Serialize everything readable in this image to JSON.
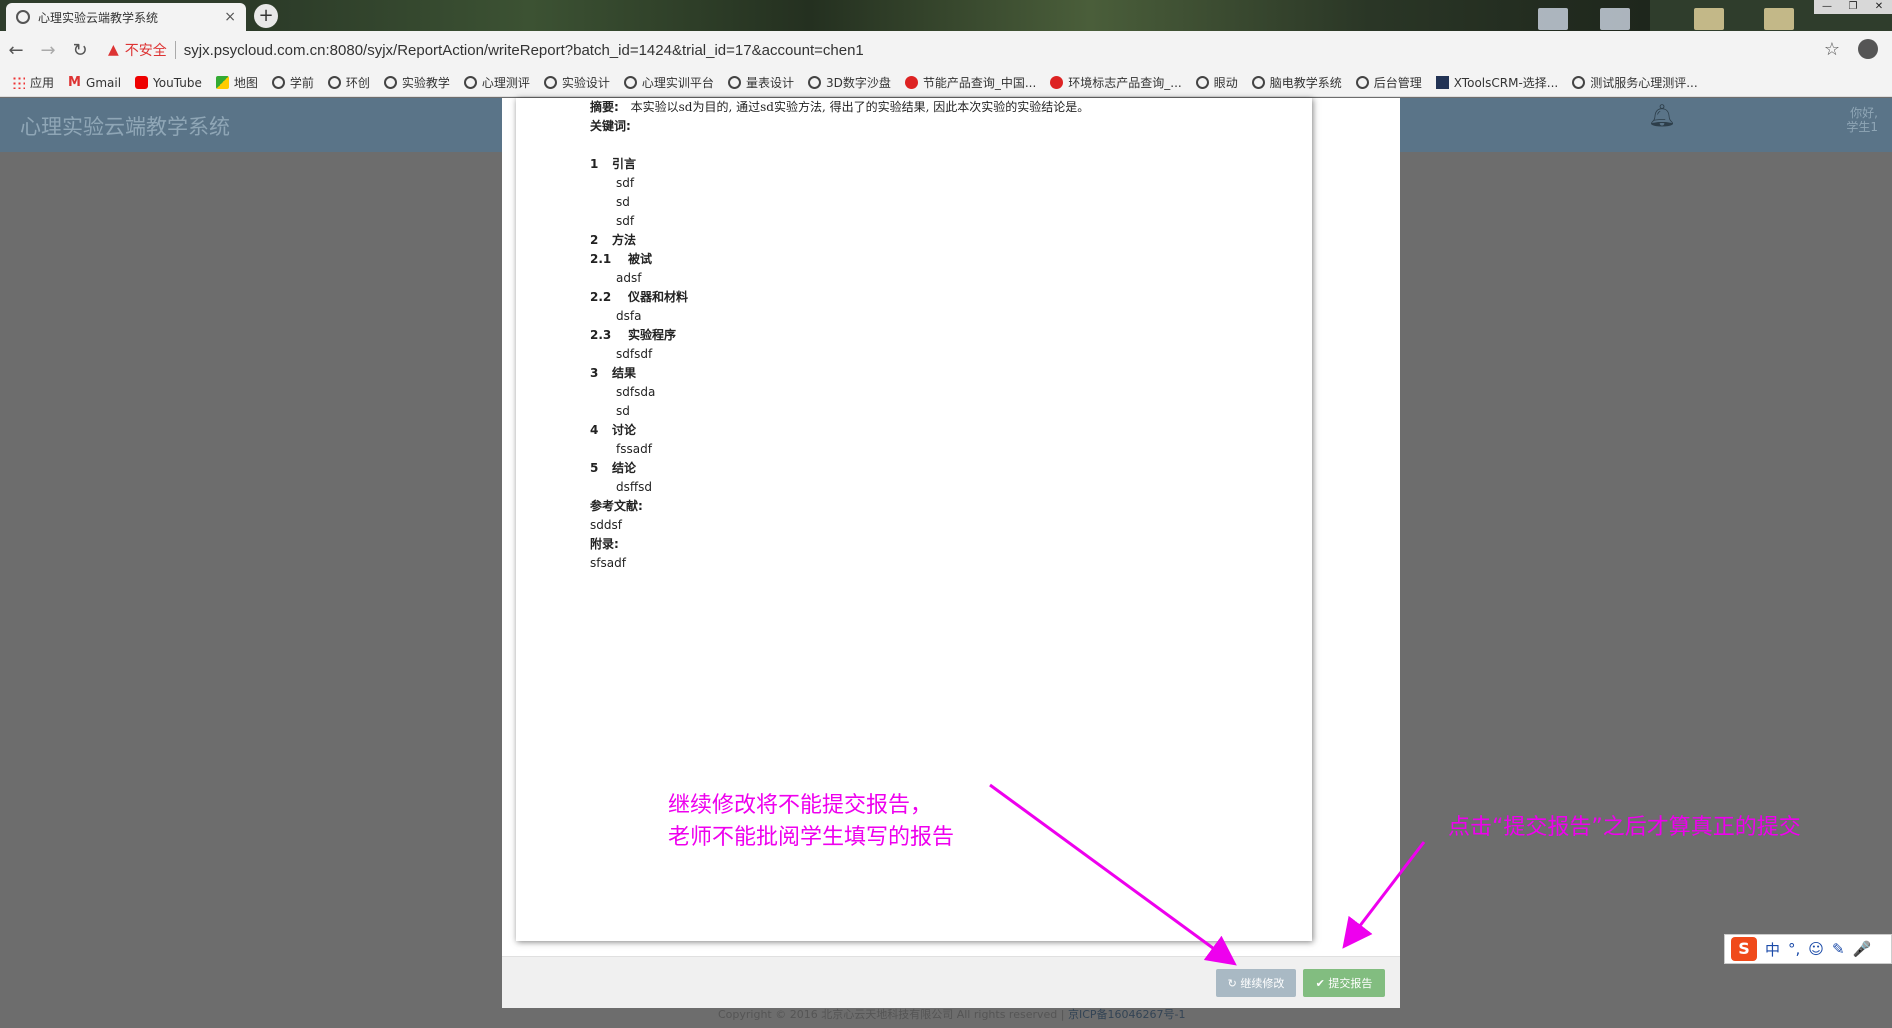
{
  "browser": {
    "tab_title": "心理实验云端教学系统",
    "tab_close": "×",
    "new_tab": "+",
    "unsafe_label": "不安全",
    "url": "syjx.psycloud.com.cn:8080/syjx/ReportAction/writeReport?batch_id=1424&trial_id=17&account=chen1",
    "bookmarks": [
      {
        "label": "应用",
        "icon": "apps-icon"
      },
      {
        "label": "Gmail",
        "icon": "gmail-icon"
      },
      {
        "label": "YouTube",
        "icon": "youtube-icon"
      },
      {
        "label": "地图",
        "icon": "maps-icon"
      },
      {
        "label": "学前",
        "icon": "globe-icon"
      },
      {
        "label": "环创",
        "icon": "globe-icon"
      },
      {
        "label": "实验教学",
        "icon": "globe-icon"
      },
      {
        "label": "心理测评",
        "icon": "globe-icon"
      },
      {
        "label": "实验设计",
        "icon": "globe-icon"
      },
      {
        "label": "心理实训平台",
        "icon": "globe-icon"
      },
      {
        "label": "量表设计",
        "icon": "globe-icon"
      },
      {
        "label": "3D数字沙盘",
        "icon": "globe-icon"
      },
      {
        "label": "节能产品查询_中国...",
        "icon": "emblem-icon"
      },
      {
        "label": "环境标志产品查询_...",
        "icon": "emblem-icon"
      },
      {
        "label": "眼动",
        "icon": "globe-icon"
      },
      {
        "label": "脑电教学系统",
        "icon": "globe-icon"
      },
      {
        "label": "后台管理",
        "icon": "globe-icon"
      },
      {
        "label": "XToolsCRM-选择...",
        "icon": "xtools-icon"
      },
      {
        "label": "测试服务心理测评...",
        "icon": "globe-icon"
      }
    ]
  },
  "app": {
    "title": "心理实验云端教学系统",
    "greeting_line1": "你好,",
    "greeting_line2": "学生1"
  },
  "report": {
    "abstract_label": "摘要:",
    "abstract_text": "本实验以sd为目的, 通过sd实验方法, 得出了的实验结果, 因此本次实验的实验结论是。",
    "keywords_label": "关键词:",
    "sections": [
      {
        "num": "1",
        "title": "引言",
        "lines": [
          "sdf",
          "sd",
          "sdf"
        ]
      },
      {
        "num": "2",
        "title": "方法",
        "lines": []
      },
      {
        "num": "2.1",
        "title": "被试",
        "lines": [
          "adsf"
        ]
      },
      {
        "num": "2.2",
        "title": "仪器和材料",
        "lines": [
          "dsfa"
        ]
      },
      {
        "num": "2.3",
        "title": "实验程序",
        "lines": [
          "sdfsdf"
        ]
      },
      {
        "num": "3",
        "title": "结果",
        "lines": [
          "sdfsda",
          "sd"
        ]
      },
      {
        "num": "4",
        "title": "讨论",
        "lines": [
          "fssadf"
        ]
      },
      {
        "num": "5",
        "title": "结论",
        "lines": [
          "dsffsd"
        ]
      }
    ],
    "references_label": "参考文献:",
    "references_text": "sddsf",
    "appendix_label": "附录:",
    "appendix_text": "sfsadf"
  },
  "buttons": {
    "continue_edit": "↻ 继续修改",
    "submit_report": "✔ 提交报告"
  },
  "annotations": {
    "note1_line1": "继续修改将不能提交报告，",
    "note1_line2": "老师不能批阅学生填写的报告",
    "note2": "点击“提交报告”之后才算真正的提交",
    "color": "#ee00ee"
  },
  "footer": {
    "copyright": "Copyright © 2016 北京心云天地科技有限公司 All rights reserved | ",
    "icp": "京ICP备16046267号-1"
  },
  "ime": {
    "logo": "S",
    "items": [
      "中",
      "°,",
      "☺",
      "✎",
      "🎤"
    ]
  }
}
